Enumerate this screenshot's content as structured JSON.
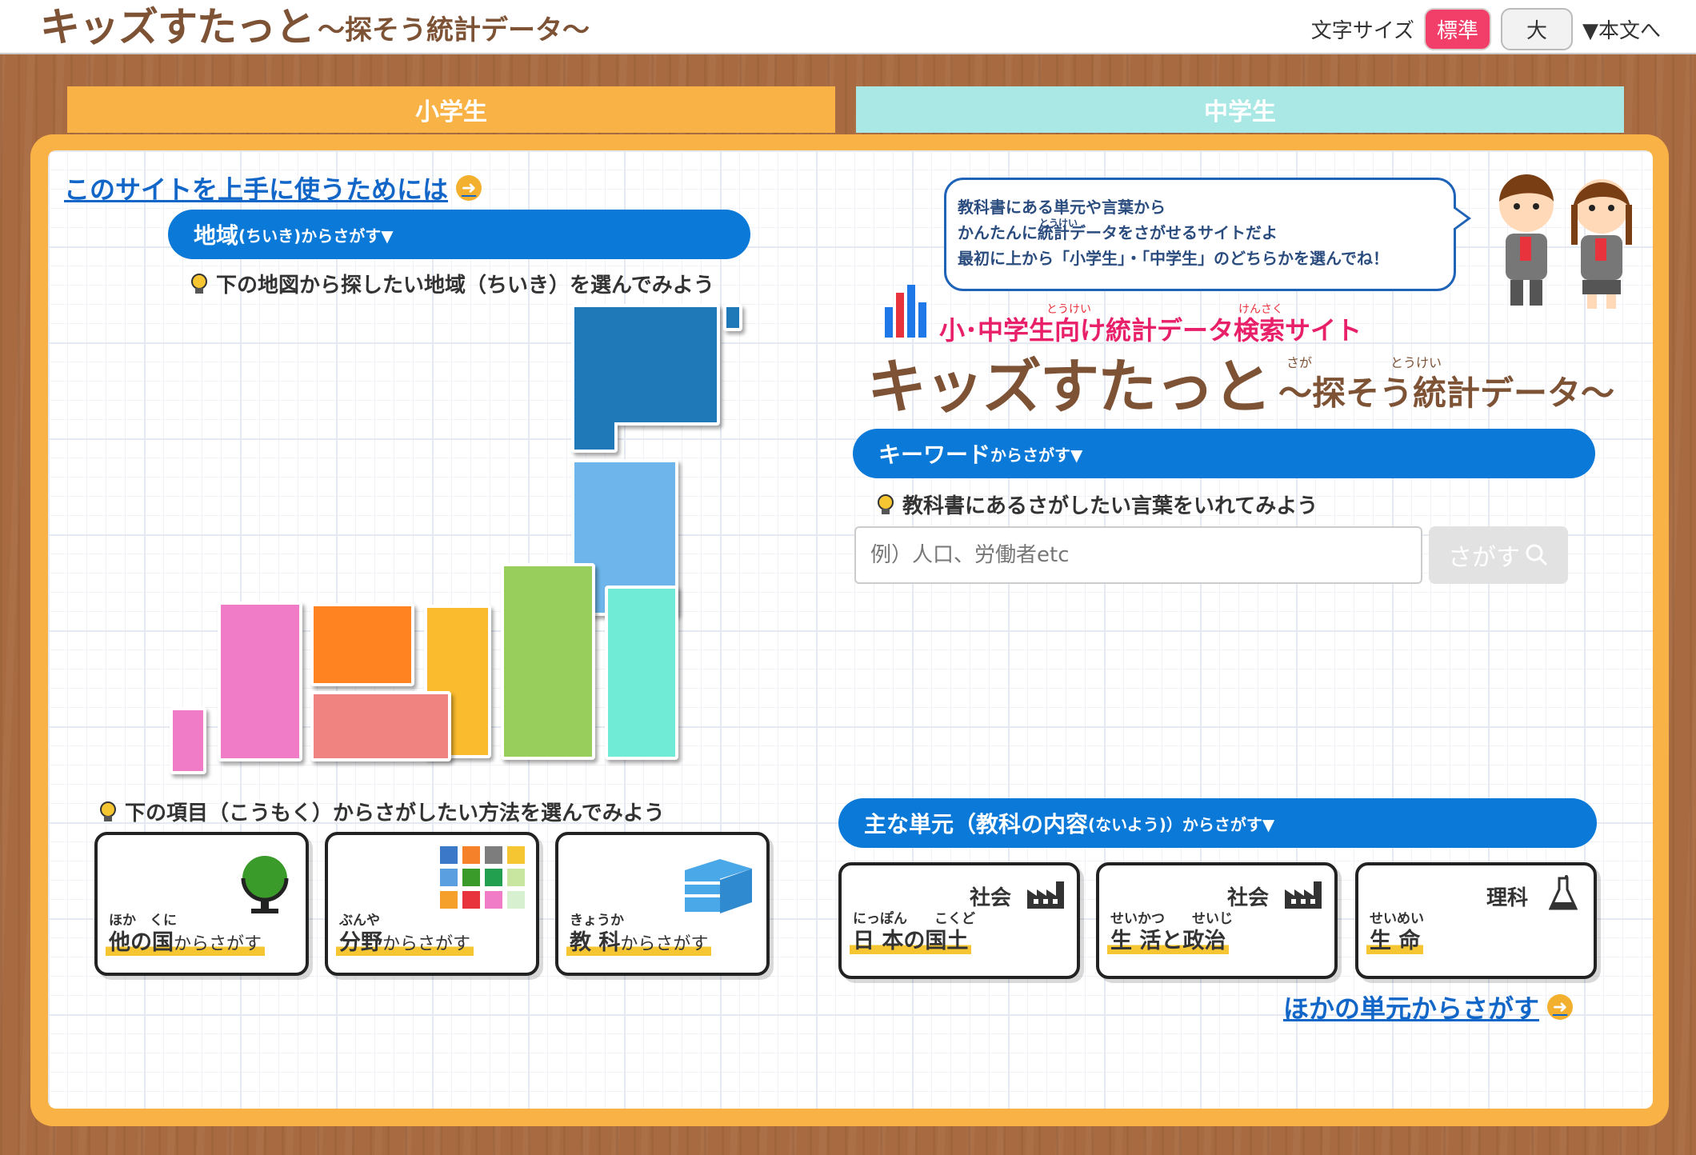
{
  "header": {
    "logo_main": "キッズすたっと",
    "logo_sub": "～探そう統計データ～",
    "font_size_label": "文字サイズ",
    "font_std": "標準",
    "font_large": "大",
    "skip_link": "▼本文へ"
  },
  "tabs": [
    {
      "label": "小学生"
    },
    {
      "label": "中学生"
    }
  ],
  "guide_link": "このサイトを上手に使うためには",
  "region_bar": {
    "label": "地域",
    "ruby": "(ちいき)",
    "suffix": "からさがす▼"
  },
  "region_hint": "下の地図から探したい地域（ちいき）を選んでみよう",
  "item_hint": "下の項目（こうもく）からさがしたい方法を選んでみよう",
  "cards_left": [
    {
      "ruby": "ほか　くに",
      "main": "他の国",
      "suffix": "からさがす"
    },
    {
      "ruby": "ぶんや",
      "main": "分野",
      "suffix": "からさがす"
    },
    {
      "ruby": "きょうか",
      "main": "教 科",
      "suffix": "からさがす"
    }
  ],
  "bubble": {
    "line1": "教科書にある単元や言葉から",
    "line2_ruby": "とうけい",
    "line2": "かんたんに統計データをさがせるサイトだよ",
    "line3": "最初に上から「小学生」・「中学生」のどちらかを選んでね！"
  },
  "brand": {
    "tagline": "小･中学生向け統計データ検索サイト",
    "tagline_ruby1": "とうけい",
    "tagline_ruby2": "けんさく",
    "title": "キッズすたっと",
    "subtitle": "～探そう統計データ～",
    "sub_ruby1": "さが",
    "sub_ruby2": "とうけい"
  },
  "keyword_bar": {
    "label": "キーワード",
    "suffix": "からさがす▼"
  },
  "keyword_hint": "教科書にあるさがしたい言葉をいれてみよう",
  "search": {
    "placeholder": "例）人口、労働者etc",
    "button": "さがす"
  },
  "unit_bar": {
    "label": "主な単元（教科の内容",
    "ruby": "(ないよう)",
    "suffix": "）からさがす▼"
  },
  "cards_right": [
    {
      "subject": "社会",
      "ruby": "にっぽん　　こくど",
      "main": "日 本の国土"
    },
    {
      "subject": "社会",
      "ruby": "せいかつ　　せいじ",
      "main": "生 活と政治"
    },
    {
      "subject": "理科",
      "ruby": "せいめい",
      "main": "生 命"
    }
  ],
  "other_units_link": "ほかの単元からさがす",
  "colors": {
    "accent_orange": "#f9b246",
    "tab_mint": "#a9e8e4",
    "bar_blue": "#0b79d8",
    "highlight": "#f23f6a"
  }
}
